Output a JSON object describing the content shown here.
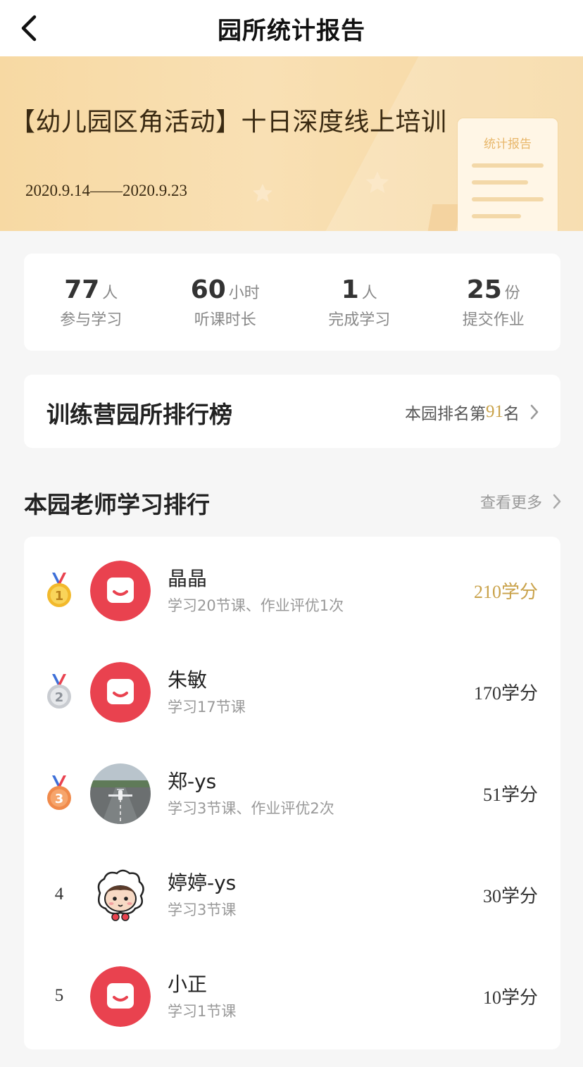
{
  "header": {
    "title": "园所统计报告",
    "back_icon": "chevron-left-icon"
  },
  "banner": {
    "title": "【幼儿园区角活动】十日深度线上培训",
    "date_range": "2020.9.14——2020.9.23",
    "card_label": "统计报告"
  },
  "stats": [
    {
      "value": "77",
      "unit": "人",
      "label": "参与学习"
    },
    {
      "value": "60",
      "unit": "小时",
      "label": "听课时长"
    },
    {
      "value": "1",
      "unit": "人",
      "label": "完成学习"
    },
    {
      "value": "25",
      "unit": "份",
      "label": "提交作业"
    }
  ],
  "ranking_board": {
    "title": "训练营园所排行榜",
    "prefix": "本园排名第",
    "rank": "91",
    "suffix": "名"
  },
  "teacher_ranking": {
    "title": "本园老师学习排行",
    "more_label": "查看更多",
    "rows": [
      {
        "rank": "1",
        "medal": "gold",
        "name": "晶晶",
        "desc": "学习20节课、作业评优1次",
        "score": "210学分",
        "avatar": "app-logo"
      },
      {
        "rank": "2",
        "medal": "silver",
        "name": "朱敏",
        "desc": "学习17节课",
        "score": "170学分",
        "avatar": "app-logo"
      },
      {
        "rank": "3",
        "medal": "bronze",
        "name": "郑-ys",
        "desc": "学习3节课、作业评优2次",
        "score": "51学分",
        "avatar": "airplane-photo"
      },
      {
        "rank": "4",
        "medal": "",
        "name": "婷婷-ys",
        "desc": "学习3节课",
        "score": "30学分",
        "avatar": "cartoon-sheep"
      },
      {
        "rank": "5",
        "medal": "",
        "name": "小正",
        "desc": "学习1节课",
        "score": "10学分",
        "avatar": "app-logo"
      }
    ]
  },
  "colors": {
    "accent_gold": "#c9a24a",
    "logo_red": "#e9424f",
    "banner": "#f7d9a3"
  }
}
